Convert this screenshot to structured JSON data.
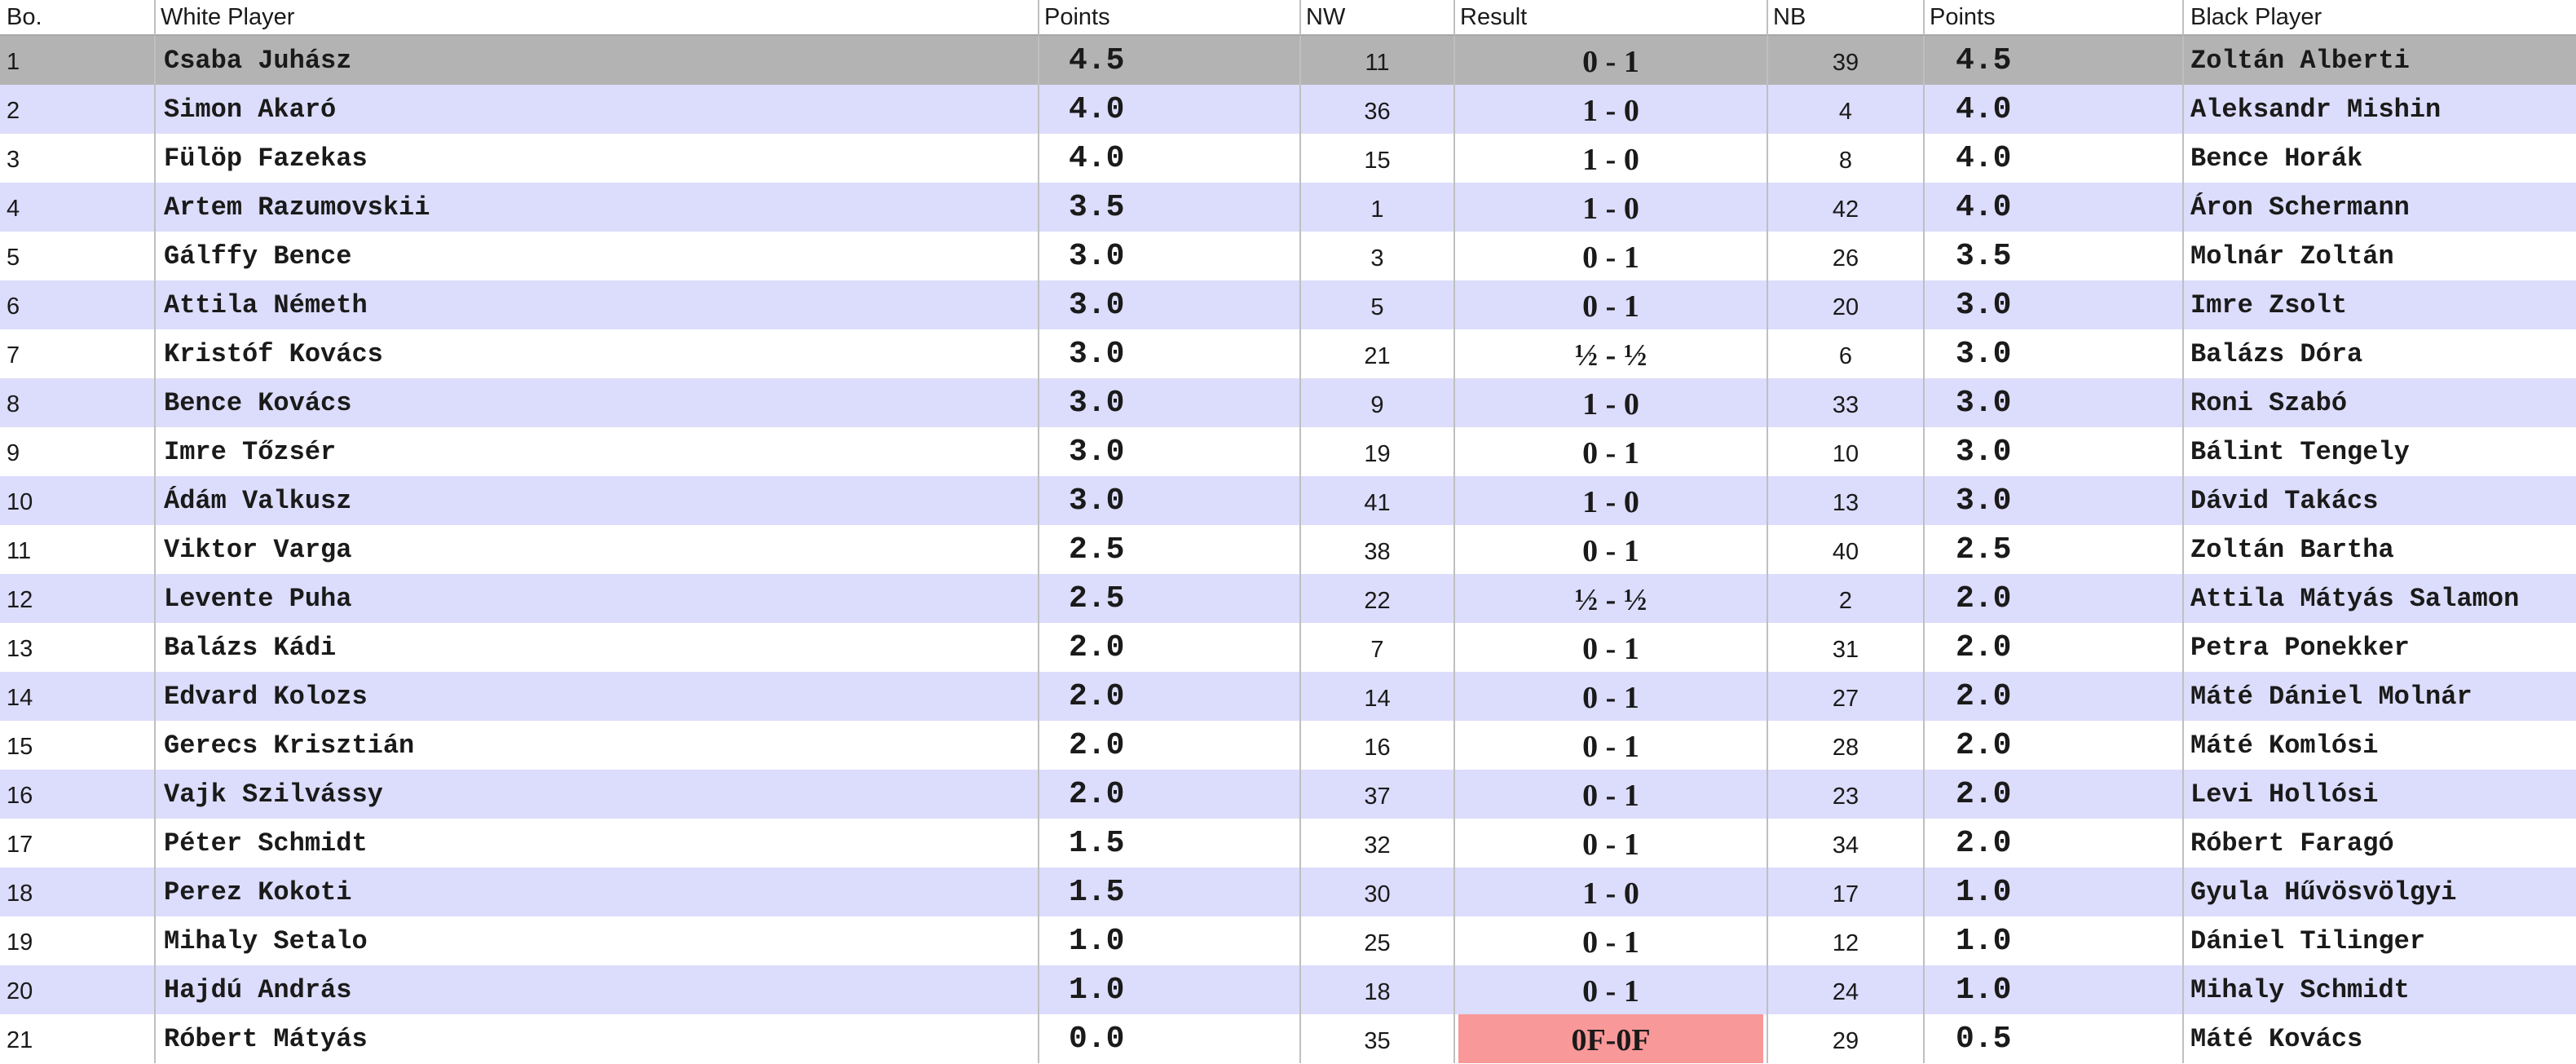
{
  "columns": {
    "board": "Bo.",
    "white_player": "White Player",
    "white_points": "Points",
    "white_number": "NW",
    "result": "Result",
    "black_number": "NB",
    "black_points": "Points",
    "black_player": "Black Player"
  },
  "colors": {
    "selected_row": "#b3b3b3",
    "alternate_row": "#dcdcfc",
    "row": "#ffffff",
    "forfeit_result": "#f99898"
  },
  "selected_board": "1",
  "rows": [
    {
      "bo": "1",
      "white": "Csaba Juhász",
      "pw": "4.5",
      "nw": "11",
      "result": "0 - 1",
      "nb": "39",
      "pb": "4.5",
      "black": "Zoltán Alberti"
    },
    {
      "bo": "2",
      "white": "Simon Akaró",
      "pw": "4.0",
      "nw": "36",
      "result": "1 - 0",
      "nb": "4",
      "pb": "4.0",
      "black": "Aleksandr Mishin"
    },
    {
      "bo": "3",
      "white": "Fülöp Fazekas",
      "pw": "4.0",
      "nw": "15",
      "result": "1 - 0",
      "nb": "8",
      "pb": "4.0",
      "black": "Bence Horák"
    },
    {
      "bo": "4",
      "white": "Artem Razumovskii",
      "pw": "3.5",
      "nw": "1",
      "result": "1 - 0",
      "nb": "42",
      "pb": "4.0",
      "black": "Áron Schermann"
    },
    {
      "bo": "5",
      "white": "Gálffy Bence",
      "pw": "3.0",
      "nw": "3",
      "result": "0 - 1",
      "nb": "26",
      "pb": "3.5",
      "black": "Molnár Zoltán"
    },
    {
      "bo": "6",
      "white": "Attila Németh",
      "pw": "3.0",
      "nw": "5",
      "result": "0 - 1",
      "nb": "20",
      "pb": "3.0",
      "black": "Imre Zsolt"
    },
    {
      "bo": "7",
      "white": "Kristóf Kovács",
      "pw": "3.0",
      "nw": "21",
      "result": "½ - ½",
      "nb": "6",
      "pb": "3.0",
      "black": "Balázs Dóra"
    },
    {
      "bo": "8",
      "white": "Bence Kovács",
      "pw": "3.0",
      "nw": "9",
      "result": "1 - 0",
      "nb": "33",
      "pb": "3.0",
      "black": "Roni Szabó"
    },
    {
      "bo": "9",
      "white": "Imre Tőzsér",
      "pw": "3.0",
      "nw": "19",
      "result": "0 - 1",
      "nb": "10",
      "pb": "3.0",
      "black": "Bálint Tengely"
    },
    {
      "bo": "10",
      "white": "Ádám Valkusz",
      "pw": "3.0",
      "nw": "41",
      "result": "1 - 0",
      "nb": "13",
      "pb": "3.0",
      "black": "Dávid Takács"
    },
    {
      "bo": "11",
      "white": "Viktor Varga",
      "pw": "2.5",
      "nw": "38",
      "result": "0 - 1",
      "nb": "40",
      "pb": "2.5",
      "black": "Zoltán Bartha"
    },
    {
      "bo": "12",
      "white": "Levente Puha",
      "pw": "2.5",
      "nw": "22",
      "result": "½ - ½",
      "nb": "2",
      "pb": "2.0",
      "black": "Attila Mátyás Salamon"
    },
    {
      "bo": "13",
      "white": "Balázs Kádi",
      "pw": "2.0",
      "nw": "7",
      "result": "0 - 1",
      "nb": "31",
      "pb": "2.0",
      "black": "Petra Ponekker"
    },
    {
      "bo": "14",
      "white": "Edvard Kolozs",
      "pw": "2.0",
      "nw": "14",
      "result": "0 - 1",
      "nb": "27",
      "pb": "2.0",
      "black": "Máté Dániel Molnár"
    },
    {
      "bo": "15",
      "white": "Gerecs Krisztián",
      "pw": "2.0",
      "nw": "16",
      "result": "0 - 1",
      "nb": "28",
      "pb": "2.0",
      "black": "Máté Komlósi"
    },
    {
      "bo": "16",
      "white": "Vajk Szilvássy",
      "pw": "2.0",
      "nw": "37",
      "result": "0 - 1",
      "nb": "23",
      "pb": "2.0",
      "black": "Levi Hollósi"
    },
    {
      "bo": "17",
      "white": "Péter Schmidt",
      "pw": "1.5",
      "nw": "32",
      "result": "0 - 1",
      "nb": "34",
      "pb": "2.0",
      "black": "Róbert Faragó"
    },
    {
      "bo": "18",
      "white": "Perez Kokoti",
      "pw": "1.5",
      "nw": "30",
      "result": "1 - 0",
      "nb": "17",
      "pb": "1.0",
      "black": "Gyula Hűvösvölgyi"
    },
    {
      "bo": "19",
      "white": "Mihaly Setalo",
      "pw": "1.0",
      "nw": "25",
      "result": "0 - 1",
      "nb": "12",
      "pb": "1.0",
      "black": "Dániel Tilinger"
    },
    {
      "bo": "20",
      "white": "Hajdú András",
      "pw": "1.0",
      "nw": "18",
      "result": "0 - 1",
      "nb": "24",
      "pb": "1.0",
      "black": "Mihaly Schmidt"
    },
    {
      "bo": "21",
      "white": "Róbert Mátyás",
      "pw": "0.0",
      "nw": "35",
      "result": "0F-0F",
      "nb": "29",
      "pb": "0.5",
      "black": "Máté Kovács",
      "forfeit": true
    }
  ]
}
